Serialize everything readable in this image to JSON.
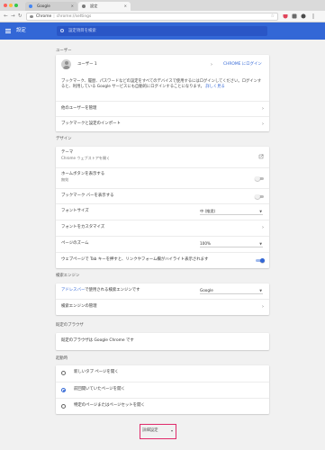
{
  "browser": {
    "tabs": [
      {
        "title": "Google",
        "active": false
      },
      {
        "title": "設定",
        "active": true
      }
    ],
    "address": {
      "host": "Chrome",
      "path": "chrome://settings"
    },
    "traffic_colors": [
      "#fc605b",
      "#fdbc40",
      "#34c84a"
    ]
  },
  "header": {
    "title": "設定",
    "search_placeholder": "設定項目を検索",
    "color": "#3367d6"
  },
  "users": {
    "section_title": "ユーザー",
    "account_name": "ユーザー 1",
    "signin_link": "CHROME にログイン",
    "signin_description": "ブックマーク、履歴、パスワードなどの設定をすべてのデバイスで使用するにはログインしてください。ログインすると、利用している Google サービスにも自動的にログインすることになります。",
    "learn_more": "詳しく見る",
    "manage_others": "他のユーザーを管理",
    "import_bookmarks": "ブックマークと設定のインポート"
  },
  "appearance": {
    "section_title": "デザイン",
    "theme_label": "テーマ",
    "theme_sub": "Chrome ウェブストアを開く",
    "home_button_label": "ホームボタンを表示する",
    "home_button_sub": "無効",
    "home_button_on": false,
    "bookmarks_bar_label": "ブックマーク バーを表示する",
    "bookmarks_bar_on": false,
    "font_size_label": "フォントサイズ",
    "font_size_value": "中 (推奨)",
    "customize_fonts_label": "フォントをカスタマイズ",
    "page_zoom_label": "ページのズーム",
    "page_zoom_value": "100%",
    "tab_highlight_label": "ウェブページで Tab キーを押すと、リンクやフォーム欄がハイライト表示されます",
    "tab_highlight_on": true
  },
  "search": {
    "section_title": "検索エンジン",
    "engine_link": "アドレスバー",
    "engine_label": "で使用される検索エンジンです",
    "engine_value": "Google",
    "manage_label": "検索エンジンの管理"
  },
  "default_browser": {
    "section_title": "既定のブラウザ",
    "status": "既定のブラウザは Google Chrome です"
  },
  "startup": {
    "section_title": "起動時",
    "options": [
      {
        "label": "新しいタブ ページを開く",
        "checked": false
      },
      {
        "label": "前回開いていたページを開く",
        "checked": true
      },
      {
        "label": "特定のページまたはページセットを開く",
        "checked": false
      }
    ]
  },
  "advanced": {
    "label": "詳細設定",
    "highlight_color": "#e02a6a"
  }
}
